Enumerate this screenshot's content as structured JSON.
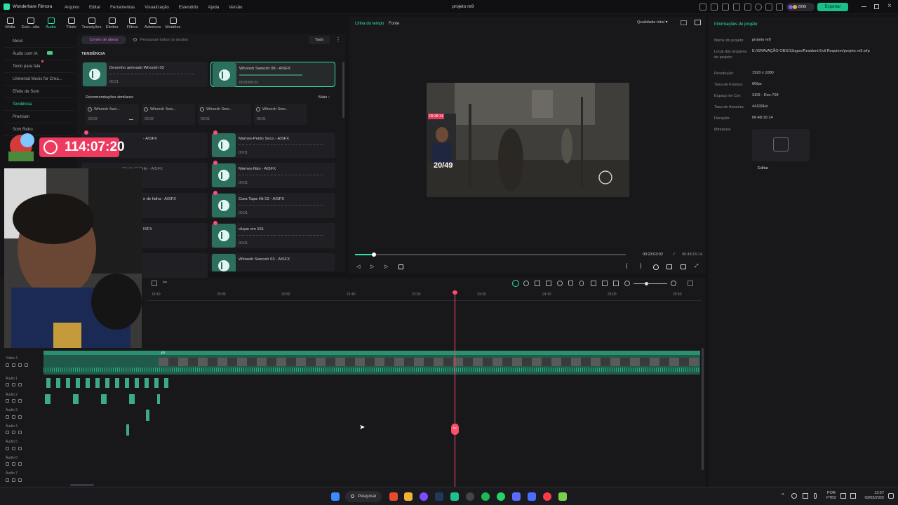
{
  "titlebar": {
    "app": "Wonderhare Filmora",
    "menu": [
      "Arquivo",
      "Editar",
      "Ferramentas",
      "Visualização",
      "Estendido",
      "Ajuda",
      "Versão"
    ],
    "project": "projeto re9",
    "credits": "2999",
    "export": "Exportar"
  },
  "tools": [
    {
      "label": "Mídia"
    },
    {
      "label": "Esto...idia"
    },
    {
      "label": "Áudio"
    },
    {
      "label": "Título"
    },
    {
      "label": "Transições"
    },
    {
      "label": "Efeitos"
    },
    {
      "label": "Filtros"
    },
    {
      "label": "Adesivos"
    },
    {
      "label": "Modelos"
    }
  ],
  "leftnav": [
    {
      "label": "Meus"
    },
    {
      "label": "Áudio com IA"
    },
    {
      "label": "Texto para fala"
    },
    {
      "label": "Universal Music for Crea..."
    },
    {
      "label": "Efeito de Som"
    },
    {
      "label": "Tendência"
    },
    {
      "label": "Premium"
    },
    {
      "label": "Som Retro"
    }
  ],
  "assets": {
    "center": "Centro de ativos",
    "search_placeholder": "Pesquisar todos os áudios",
    "filter": "Tudo",
    "trend": "TENDÊNCIA",
    "top_cards": [
      {
        "name": "Desenho animado Whoosh 02",
        "dur": "00:01"
      },
      {
        "name": "Whoosh Swoosh 08 - AISFX",
        "dur": "00:00/00:01"
      }
    ],
    "sim_title": "Recomendações similares",
    "more": "Mais",
    "similar": [
      {
        "name": "Whoosh Swo...",
        "dur": "00:02"
      },
      {
        "name": "Whoosh Swo...",
        "dur": "00:02"
      },
      {
        "name": "Whoosh Swo...",
        "dur": "00:01"
      },
      {
        "name": "Whoosh Swo...",
        "dur": "00:01"
      }
    ],
    "left_list": [
      {
        "name": "- AISFX"
      },
      {
        "name": "Sheim O Grilo - AISFX"
      },
      {
        "name": "e de falha - AISFX"
      },
      {
        "name": "ISFX"
      },
      {
        "name": ""
      }
    ],
    "right_list": [
      {
        "name": "Memes-Peido Seco - AISFX",
        "dur": "00:01"
      },
      {
        "name": "Memes-Não - AISFX",
        "dur": "00:01"
      },
      {
        "name": "Cara Tapa-Hit 03 - AISFX",
        "dur": "00:01"
      },
      {
        "name": "clique em 151",
        "dur": "00:01"
      },
      {
        "name": "Whoosh Swoosh 03 - AISFX",
        "dur": ""
      }
    ]
  },
  "preview": {
    "tab_timeline": "Linha do tempo",
    "tab_source": "Fonte",
    "quality": "Qualidade total",
    "current": "00:23:03:02",
    "sep": "/",
    "total": "06:48:16:14",
    "progress": 0.07,
    "score": "20/49",
    "overlay_tag": "09:28:14"
  },
  "overlay": {
    "timer": "114:07:20"
  },
  "info": {
    "title": "Informações do projeto",
    "rows": [
      {
        "label": "Nome do projeto:",
        "value": "projeto re9"
      },
      {
        "label": "Local dos arquivos do projeto:",
        "value": "E:/GRAVAÇÃO OBS/13ogos/Resident Evil Requiem/projeto re9.wfp"
      },
      {
        "label": "Resolução:",
        "value": "1920 x 1080"
      },
      {
        "label": "Taxa de Frames:",
        "value": "60fps"
      },
      {
        "label": "Espaço de Cor:",
        "value": "SDR - Rec.709"
      },
      {
        "label": "Taxa de Amostra:",
        "value": "44100Hz"
      },
      {
        "label": "Duração:",
        "value": "06:48:16:14"
      },
      {
        "label": "Miniatura:",
        "value": ""
      }
    ],
    "edit": "Editar"
  },
  "timeline": {
    "ruler": [
      "19:10",
      "20:00",
      "20:50",
      "21:40",
      "22:30",
      "23:20",
      "24:10",
      "25:00",
      "25:50"
    ],
    "tracks": [
      "Vídeo 1",
      "Áudio 1",
      "Áudio 2",
      "Áudio 3",
      "Áudio 4",
      "Áudio 5",
      "Áudio 6",
      "Áudio 7"
    ],
    "clip_tag": "p0"
  },
  "taskbar": {
    "search": "Pesquisar",
    "lang1": "POR",
    "lang2": "PTB2",
    "time": "13:57",
    "date": "03/03/2026"
  },
  "colors": {
    "accent": "#2de2a8",
    "playhead": "#ff4d6a",
    "export": "#18c08a"
  }
}
